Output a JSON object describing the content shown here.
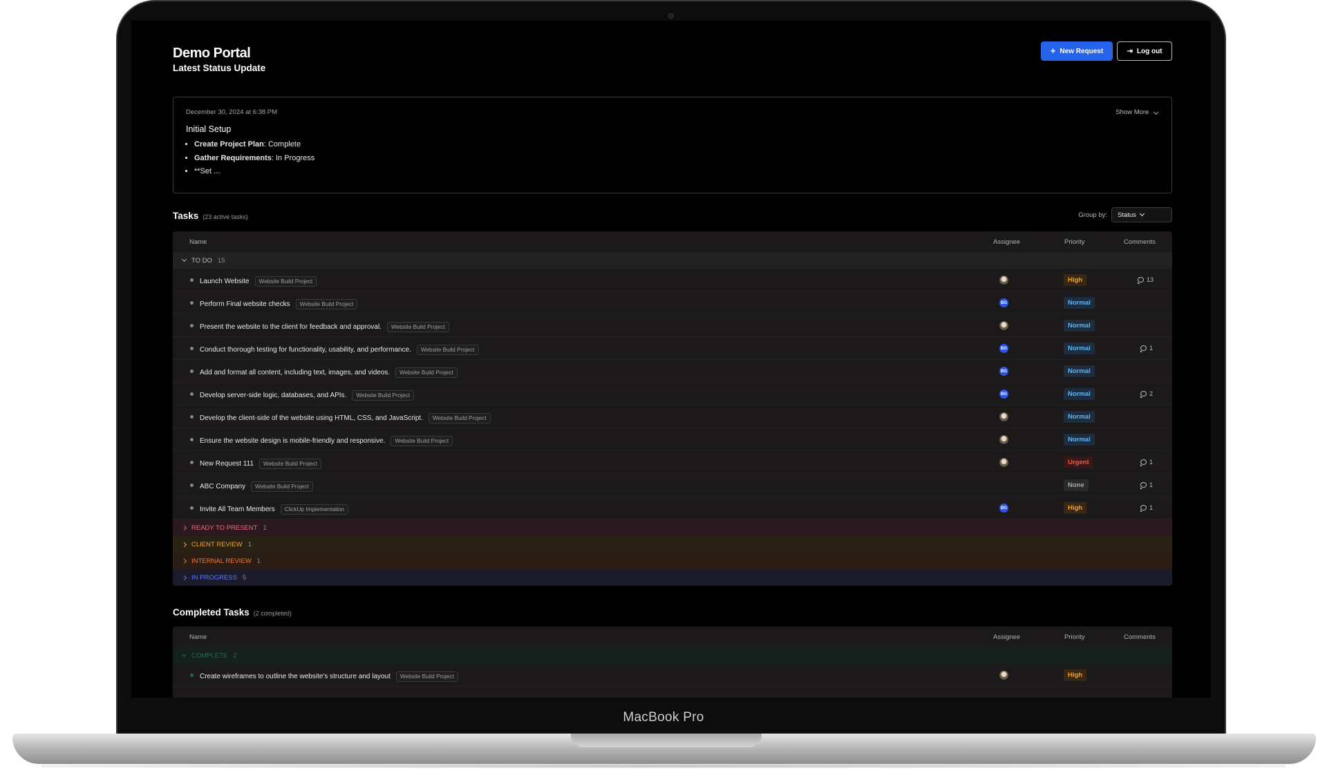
{
  "device": {
    "label": "MacBook Pro"
  },
  "header": {
    "brand": "Demo Portal",
    "new_request": "New Request",
    "logout": "Log out"
  },
  "status_update": {
    "heading": "Latest Status Update",
    "date": "December 30, 2024 at 6:38 PM",
    "show_more": "Show More",
    "title": "Initial Setup",
    "items": [
      {
        "bold": "Create Project Plan",
        "text": ": Complete"
      },
      {
        "bold": "Gather Requirements",
        "text": ": In Progress"
      },
      {
        "bold": "",
        "text": "**Set ..."
      }
    ]
  },
  "tasks": {
    "heading": "Tasks",
    "subheading": "(23 active tasks)",
    "group_by_label": "Group by:",
    "group_by_value": "Status",
    "columns": {
      "name": "Name",
      "assignee": "Assignee",
      "priority": "Priority",
      "comments": "Comments"
    },
    "groups": [
      {
        "label": "TO DO",
        "count": "15",
        "expanded": true
      },
      {
        "label": "READY TO PRESENT",
        "count": "1",
        "expanded": false
      },
      {
        "label": "CLIENT REVIEW",
        "count": "1",
        "expanded": false
      },
      {
        "label": "INTERNAL REVIEW",
        "count": "1",
        "expanded": false
      },
      {
        "label": "IN PROGRESS",
        "count": "5",
        "expanded": false
      }
    ],
    "rows": [
      {
        "name": "Launch Website",
        "tag": "Website Build Project",
        "assignee": "photo",
        "priority": "High",
        "comments": "13"
      },
      {
        "name": "Perform Final website checks",
        "tag": "Website Build Project",
        "assignee": "BG",
        "priority": "Normal",
        "comments": ""
      },
      {
        "name": "Present the website to the client for feedback and approval.",
        "tag": "Website Build Project",
        "assignee": "photo",
        "priority": "Normal",
        "comments": ""
      },
      {
        "name": "Conduct thorough testing for functionality, usability, and performance.",
        "tag": "Website Build Project",
        "assignee": "BG",
        "priority": "Normal",
        "comments": "1"
      },
      {
        "name": "Add and format all content, including text, images, and videos.",
        "tag": "Website Build Project",
        "assignee": "BG",
        "priority": "Normal",
        "comments": ""
      },
      {
        "name": "Develop server-side logic, databases, and APIs.",
        "tag": "Website Build Project",
        "assignee": "BG",
        "priority": "Normal",
        "comments": "2"
      },
      {
        "name": "Develop the client-side of the website using HTML, CSS, and JavaScript.",
        "tag": "Website Build Project",
        "assignee": "photo",
        "priority": "Normal",
        "comments": ""
      },
      {
        "name": "Ensure the website design is mobile-friendly and responsive.",
        "tag": "Website Build Project",
        "assignee": "photo",
        "priority": "Normal",
        "comments": ""
      },
      {
        "name": "New Request 111",
        "tag": "Website Build Project",
        "assignee": "photo",
        "priority": "Urgent",
        "comments": "1"
      },
      {
        "name": "ABC Company",
        "tag": "Website Build Project",
        "assignee": "",
        "priority": "None",
        "comments": "1"
      },
      {
        "name": "Invite All Team Members",
        "tag": "ClickUp Implementation",
        "assignee": "BG",
        "priority": "High",
        "comments": "1"
      }
    ]
  },
  "completed": {
    "heading": "Completed Tasks",
    "subheading": "(2 completed)",
    "group": {
      "label": "COMPLETE",
      "count": "2"
    },
    "rows": [
      {
        "name": "Create wireframes to outline the website's structure and layout",
        "tag": "Website Build Project",
        "assignee": "photo",
        "priority": "High",
        "comments": ""
      }
    ]
  },
  "colors": {
    "accent": "#2563eb",
    "high": "#f0a030",
    "normal": "#62b4ef",
    "urgent": "#f05a47"
  }
}
